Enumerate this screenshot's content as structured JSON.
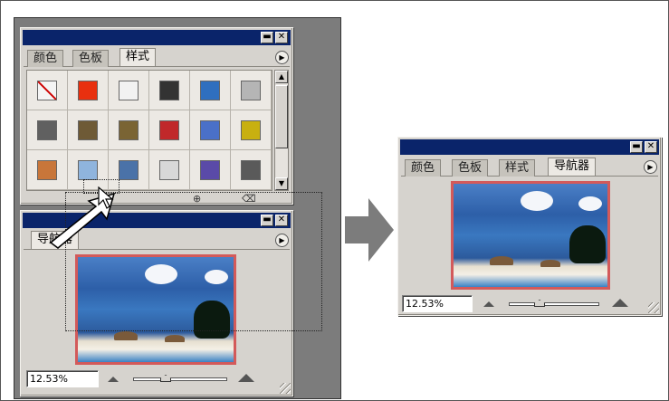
{
  "left_styles_palette": {
    "tabs": [
      "颜色",
      "色板",
      "样式"
    ],
    "active_tab": "样式",
    "title_buttons": [
      "minimize",
      "close"
    ],
    "swatches": [
      [
        "#f4f4f4",
        "#e8300f",
        "#f2f2f2",
        "#333333",
        "#2f6fbf",
        "#b5b5b5"
      ],
      [
        "#606060",
        "#6e5a36",
        "#7a6434",
        "#c0282a",
        "#4a70c8",
        "#c8b010"
      ],
      [
        "#c8763a",
        "#8fb4dd",
        "#4a72a8",
        "#d8d8d8",
        "#5a4aa8",
        "#5a5a5a"
      ]
    ],
    "swatch_icons": [
      "no-style-icon",
      "glow-icon",
      "bevel-icon",
      "dark-sphere-icon",
      "blue-bevel-icon",
      "gray-icon"
    ]
  },
  "left_navigator_panel": {
    "tab": "导航器",
    "zoom": "12.53%"
  },
  "right_combined_palette": {
    "tabs": [
      "颜色",
      "色板",
      "样式",
      "导航器"
    ],
    "active_tab": "导航器",
    "zoom": "12.53%"
  },
  "icons": {
    "minimize": "minimize-icon",
    "close": "close-icon",
    "menu": "palette-menu-icon",
    "zoom_out": "zoom-out-mountain-icon",
    "zoom_in": "zoom-in-mountain-icon",
    "arrow": "transition-arrow-icon",
    "cursor": "mouse-cursor-icon"
  },
  "colors": {
    "titlebar": "#0a246a",
    "panel": "#d6d3ce",
    "workspace": "#7c7c7c",
    "nav_frame": "#d35a5a"
  }
}
